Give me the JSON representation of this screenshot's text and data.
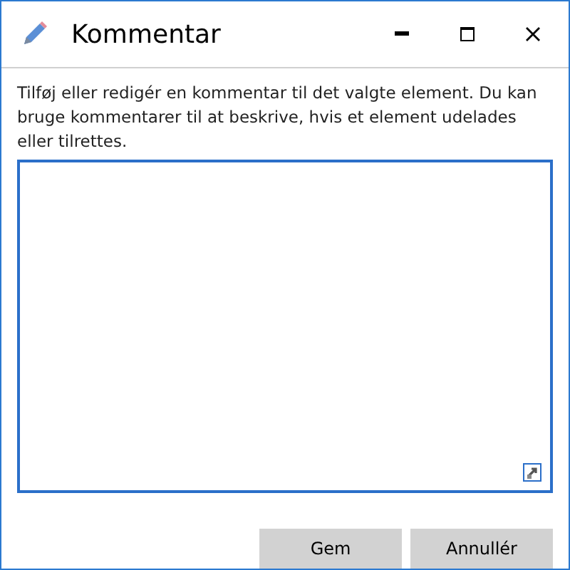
{
  "window": {
    "title": "Kommentar"
  },
  "description": "Tilføj eller redigér en kommentar til det valgte element. Du kan bruge kommentarer til at beskrive, hvis et element udelades eller tilrettes.",
  "buttons": [
    {
      "label": "Gem"
    },
    {
      "label": "Annullér"
    }
  ]
}
